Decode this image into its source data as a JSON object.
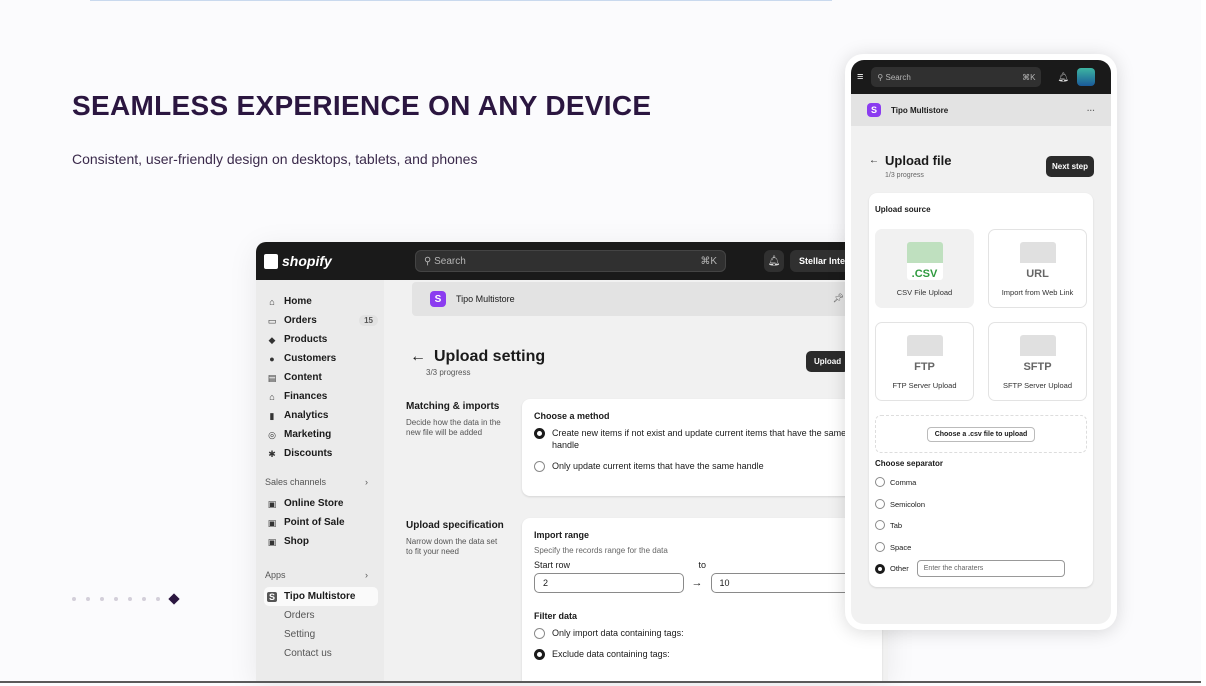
{
  "slide": {
    "headline": "SEAMLESS EXPERIENCE ON ANY DEVICE",
    "subline": "Consistent, user-friendly design on desktops, tablets, and phones",
    "dots_count": 7
  },
  "desktop": {
    "logo": "shopify",
    "search_placeholder": "Search",
    "search_shortcut": "⌘K",
    "store_name": "Stellar Inter",
    "nav": [
      {
        "label": "Home",
        "icon": "home-icon"
      },
      {
        "label": "Orders",
        "icon": "orders-icon",
        "badge": "15"
      },
      {
        "label": "Products",
        "icon": "tag-icon"
      },
      {
        "label": "Customers",
        "icon": "person-icon"
      },
      {
        "label": "Content",
        "icon": "content-icon"
      },
      {
        "label": "Finances",
        "icon": "bank-icon"
      },
      {
        "label": "Analytics",
        "icon": "chart-icon"
      },
      {
        "label": "Marketing",
        "icon": "target-icon"
      },
      {
        "label": "Discounts",
        "icon": "discount-icon"
      }
    ],
    "sales_channels_label": "Sales channels",
    "sales_channels": [
      {
        "label": "Online Store",
        "icon": "store-icon"
      },
      {
        "label": "Point of Sale",
        "icon": "pos-icon"
      },
      {
        "label": "Shop",
        "icon": "shop-icon"
      }
    ],
    "apps_label": "Apps",
    "app_name": "Tipo Multistore",
    "app_subitems": [
      "Orders",
      "Setting",
      "Contact us"
    ],
    "app_bar_title": "Tipo Multistore",
    "page_title": "Upload setting",
    "page_progress": "3/3 progress",
    "upload_button": "Upload",
    "matching": {
      "title": "Matching & imports",
      "desc": "Decide how the data in the new file will be added",
      "card_title": "Choose a method",
      "option1": "Create new items if not exist and update current items that have the same handle",
      "option2": "Only update current items that have the same handle"
    },
    "spec": {
      "title": "Upload specification",
      "desc": "Narrow down the data set to fit your need",
      "card_title": "Import range",
      "card_desc": "Specify the records range for the data",
      "start_label": "Start row",
      "to_label": "to",
      "start_value": "2",
      "end_value": "10",
      "filter_title": "Filter data",
      "filter_opt1": "Only import data containing tags:",
      "filter_opt2": "Exclude data containing tags:"
    }
  },
  "phone": {
    "search_placeholder": "Search",
    "search_shortcut": "⌘K",
    "app_bar_title": "Tipo Multistore",
    "more": "···",
    "page_title": "Upload file",
    "page_progress": "1/3 progress",
    "next_button": "Next step",
    "upload_source_title": "Upload source",
    "sources": [
      {
        "label": "CSV File Upload",
        "tag": ".CSV"
      },
      {
        "label": "Import from Web Link",
        "tag": "URL"
      },
      {
        "label": "FTP Server Upload",
        "tag": "FTP"
      },
      {
        "label": "SFTP Server Upload",
        "tag": "SFTP"
      }
    ],
    "choose_file_button": "Choose a .csv file to upload",
    "separator_title": "Choose separator",
    "separators": [
      "Comma",
      "Semicolon",
      "Tab",
      "Space",
      "Other"
    ],
    "other_placeholder": "Enter the charaters"
  }
}
